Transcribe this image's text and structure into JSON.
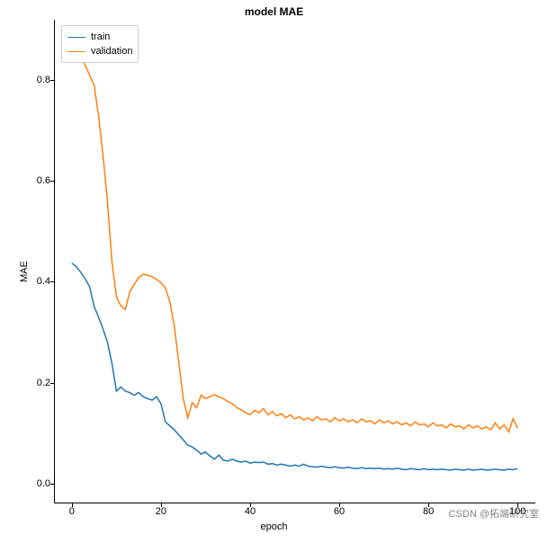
{
  "chart_data": {
    "type": "line",
    "title": "model MAE",
    "xlabel": "epoch",
    "ylabel": "MAE",
    "xlim": [
      -4,
      104
    ],
    "ylim": [
      -0.04,
      0.92
    ],
    "x_ticks": [
      0,
      20,
      40,
      60,
      80,
      100
    ],
    "y_ticks": [
      0.0,
      0.2,
      0.4,
      0.6,
      0.8
    ],
    "x": [
      0,
      1,
      2,
      3,
      4,
      5,
      6,
      7,
      8,
      9,
      10,
      11,
      12,
      13,
      14,
      15,
      16,
      17,
      18,
      19,
      20,
      21,
      22,
      23,
      24,
      25,
      26,
      27,
      28,
      29,
      30,
      31,
      32,
      33,
      34,
      35,
      36,
      37,
      38,
      39,
      40,
      41,
      42,
      43,
      44,
      45,
      46,
      47,
      48,
      49,
      50,
      51,
      52,
      53,
      54,
      55,
      56,
      57,
      58,
      59,
      60,
      61,
      62,
      63,
      64,
      65,
      66,
      67,
      68,
      69,
      70,
      71,
      72,
      73,
      74,
      75,
      76,
      77,
      78,
      79,
      80,
      81,
      82,
      83,
      84,
      85,
      86,
      87,
      88,
      89,
      90,
      91,
      92,
      93,
      94,
      95,
      96,
      97,
      98,
      99,
      100
    ],
    "series": [
      {
        "name": "train",
        "color": "#1f77b4",
        "values": [
          0.437,
          0.43,
          0.419,
          0.406,
          0.39,
          0.351,
          0.33,
          0.306,
          0.28,
          0.238,
          0.183,
          0.191,
          0.183,
          0.18,
          0.175,
          0.18,
          0.172,
          0.168,
          0.165,
          0.172,
          0.158,
          0.122,
          0.114,
          0.106,
          0.096,
          0.086,
          0.076,
          0.072,
          0.066,
          0.058,
          0.062,
          0.054,
          0.048,
          0.056,
          0.046,
          0.044,
          0.048,
          0.044,
          0.042,
          0.044,
          0.04,
          0.042,
          0.041,
          0.042,
          0.038,
          0.039,
          0.036,
          0.038,
          0.036,
          0.034,
          0.036,
          0.034,
          0.038,
          0.034,
          0.033,
          0.032,
          0.034,
          0.032,
          0.031,
          0.033,
          0.031,
          0.03,
          0.032,
          0.03,
          0.029,
          0.031,
          0.029,
          0.03,
          0.029,
          0.03,
          0.028,
          0.029,
          0.028,
          0.03,
          0.028,
          0.027,
          0.029,
          0.028,
          0.027,
          0.029,
          0.027,
          0.028,
          0.027,
          0.028,
          0.027,
          0.026,
          0.028,
          0.027,
          0.026,
          0.028,
          0.026,
          0.027,
          0.028,
          0.026,
          0.027,
          0.028,
          0.027,
          0.026,
          0.028,
          0.027,
          0.029
        ]
      },
      {
        "name": "validation",
        "color": "#ff7f0e",
        "values": [
          0.89,
          0.87,
          0.85,
          0.83,
          0.81,
          0.79,
          0.73,
          0.65,
          0.56,
          0.44,
          0.37,
          0.352,
          0.345,
          0.38,
          0.395,
          0.408,
          0.415,
          0.413,
          0.41,
          0.405,
          0.398,
          0.388,
          0.36,
          0.31,
          0.24,
          0.168,
          0.13,
          0.16,
          0.15,
          0.175,
          0.168,
          0.172,
          0.176,
          0.172,
          0.168,
          0.162,
          0.158,
          0.15,
          0.146,
          0.14,
          0.136,
          0.145,
          0.14,
          0.148,
          0.136,
          0.142,
          0.134,
          0.138,
          0.13,
          0.136,
          0.128,
          0.132,
          0.126,
          0.13,
          0.124,
          0.132,
          0.126,
          0.128,
          0.122,
          0.13,
          0.124,
          0.128,
          0.122,
          0.126,
          0.12,
          0.128,
          0.122,
          0.124,
          0.118,
          0.126,
          0.12,
          0.124,
          0.118,
          0.122,
          0.116,
          0.12,
          0.114,
          0.122,
          0.116,
          0.118,
          0.112,
          0.12,
          0.114,
          0.116,
          0.11,
          0.118,
          0.112,
          0.114,
          0.108,
          0.116,
          0.11,
          0.114,
          0.108,
          0.112,
          0.106,
          0.12,
          0.108,
          0.116,
          0.102,
          0.128,
          0.109
        ]
      }
    ]
  },
  "watermark": "CSDN @拓端研究室"
}
